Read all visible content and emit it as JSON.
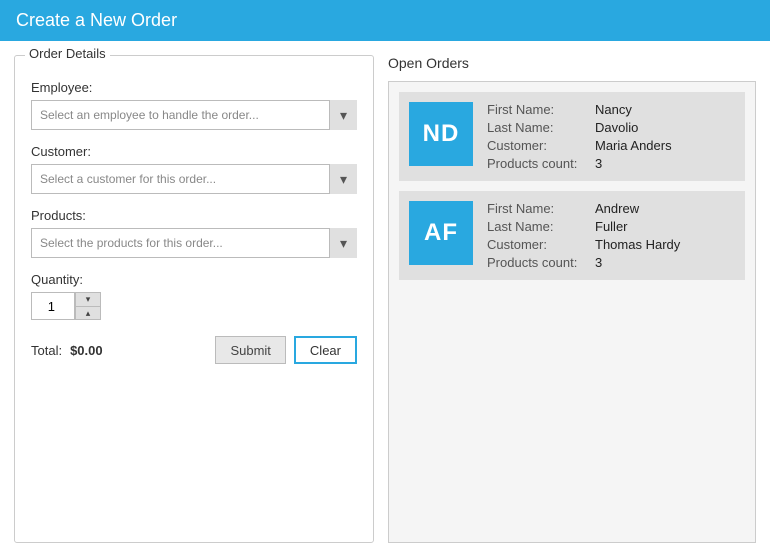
{
  "window": {
    "title": "Create a New Order"
  },
  "orderDetails": {
    "legend": "Order Details",
    "employeeLabel": "Employee:",
    "employeePlaceholder": "Select an employee to handle the order...",
    "customerLabel": "Customer:",
    "customerPlaceholder": "Select a customer for this order...",
    "productsLabel": "Products:",
    "productsPlaceholder": "Select the products for this order...",
    "quantityLabel": "Quantity:",
    "quantityValue": "1",
    "totalLabel": "Total:",
    "totalValue": "$0.00",
    "submitLabel": "Submit",
    "clearLabel": "Clear"
  },
  "openOrders": {
    "title": "Open Orders",
    "orders": [
      {
        "initials": "ND",
        "fields": [
          {
            "key": "First Name:",
            "value": "Nancy"
          },
          {
            "key": "Last Name:",
            "value": "Davolio"
          },
          {
            "key": "Customer:",
            "value": "Maria Anders"
          },
          {
            "key": "Products count:",
            "value": "3"
          }
        ]
      },
      {
        "initials": "AF",
        "fields": [
          {
            "key": "First Name:",
            "value": "Andrew"
          },
          {
            "key": "Last Name:",
            "value": "Fuller"
          },
          {
            "key": "Customer:",
            "value": "Thomas Hardy"
          },
          {
            "key": "Products count:",
            "value": "3"
          }
        ]
      }
    ]
  }
}
